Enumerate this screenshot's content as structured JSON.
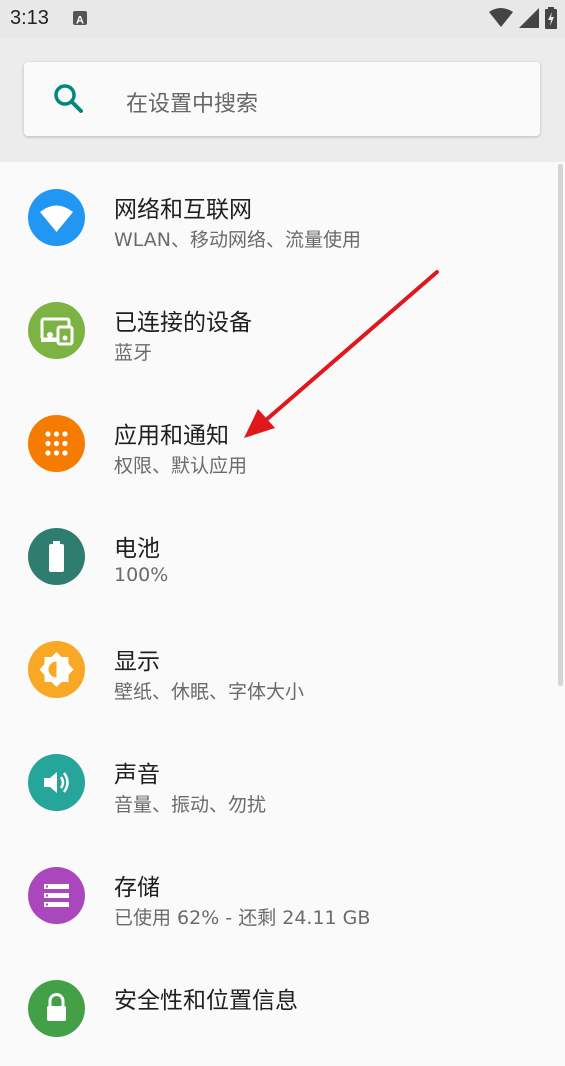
{
  "status_bar": {
    "time": "3:13",
    "notification_icon": "a-letter-icon",
    "wifi_icon": "wifi-full-icon",
    "signal_icon": "cell-signal-icon",
    "battery_icon": "battery-charging-icon"
  },
  "search": {
    "placeholder": "在设置中搜索",
    "icon": "search-icon",
    "accent": "#00897b"
  },
  "settings": [
    {
      "title": "网络和互联网",
      "subtitle": "WLAN、移动网络、流量使用",
      "icon": "wifi-icon",
      "color": "#2196f3"
    },
    {
      "title": "已连接的设备",
      "subtitle": "蓝牙",
      "icon": "devices-icon",
      "color": "#7cb342"
    },
    {
      "title": "应用和通知",
      "subtitle": "权限、默认应用",
      "icon": "apps-grid-icon",
      "color": "#f57c00"
    },
    {
      "title": "电池",
      "subtitle": "100%",
      "icon": "battery-icon",
      "color": "#2e7d6f"
    },
    {
      "title": "显示",
      "subtitle": "壁纸、休眠、字体大小",
      "icon": "brightness-icon",
      "color": "#f9a825"
    },
    {
      "title": "声音",
      "subtitle": "音量、振动、勿扰",
      "icon": "volume-icon",
      "color": "#26a69a"
    },
    {
      "title": "存储",
      "subtitle": "已使用 62% - 还剩 24.11 GB",
      "icon": "storage-icon",
      "color": "#ab47bc"
    },
    {
      "title": "安全性和位置信息",
      "subtitle": "",
      "icon": "lock-icon",
      "color": "#43a047"
    }
  ],
  "annotation": {
    "color": "#e0171d"
  }
}
